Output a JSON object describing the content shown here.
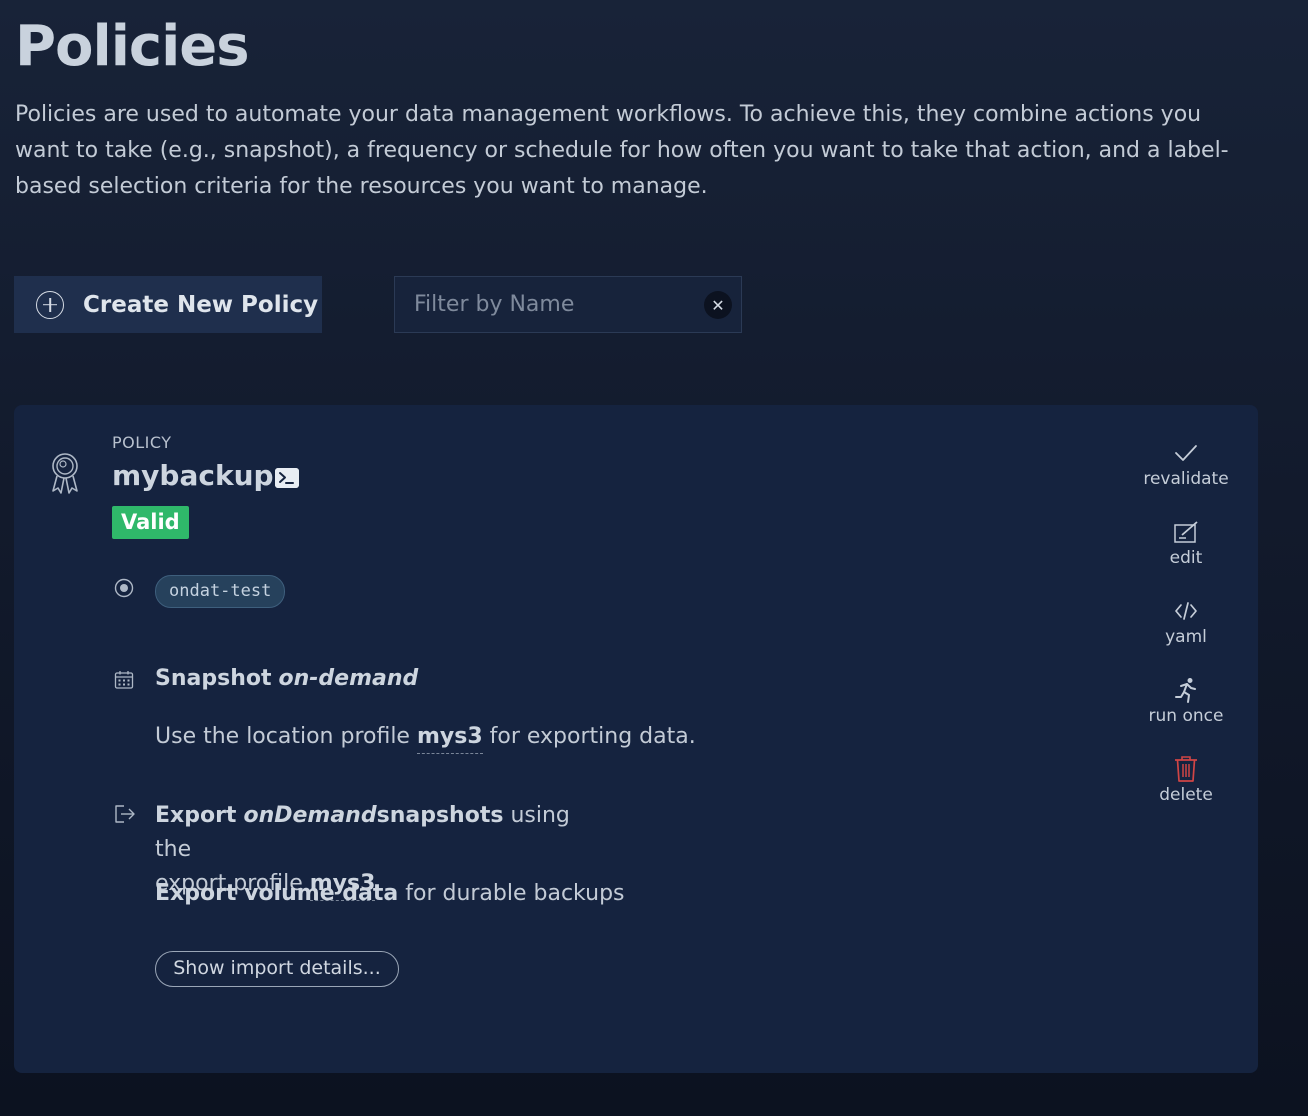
{
  "page": {
    "title": "Policies",
    "intro": "Policies are used to automate your data management workflows. To achieve this, they combine actions you want to take (e.g., snapshot), a frequency or schedule for how often you want to take that action, and a label-based selection criteria for the resources you want to manage."
  },
  "toolbar": {
    "create_label": "Create New Policy",
    "filter_placeholder": "Filter by Name",
    "filter_value": ""
  },
  "policy": {
    "kind": "POLICY",
    "name": "mybackup",
    "status": "Valid",
    "selector": "ondat-test",
    "snapshot_label": "Snapshot",
    "snapshot_frequency": "on-demand",
    "location_prefix": "Use the location profile",
    "location_profile": "mys3",
    "location_suffix": "for exporting data.",
    "export_label": "Export",
    "export_frequency": "onDemand",
    "export_snapshots": "snapshots",
    "export_using": "using the",
    "export_profile_prefix": "export profile",
    "export_profile": "mys3",
    "volume_label": "Export volume data",
    "volume_suffix": "for durable backups",
    "show_import_label": "Show import details..."
  },
  "actions": {
    "revalidate": "revalidate",
    "edit": "edit",
    "yaml": "yaml",
    "run_once": "run once",
    "delete": "delete"
  },
  "colors": {
    "background": "#121b2e",
    "card": "#15233f",
    "valid_badge": "#2fb86a",
    "delete_icon": "#d04545"
  }
}
